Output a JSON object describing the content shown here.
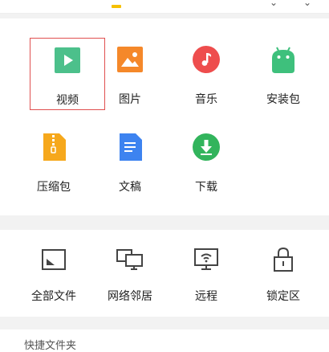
{
  "categories": [
    {
      "label": "视频",
      "icon": "video-icon",
      "color": "#4cc08b"
    },
    {
      "label": "图片",
      "icon": "image-icon",
      "color": "#f5882a"
    },
    {
      "label": "音乐",
      "icon": "music-icon",
      "color": "#ee4d4d"
    },
    {
      "label": "安装包",
      "icon": "android-icon",
      "color": "#3ec07c"
    },
    {
      "label": "压缩包",
      "icon": "zip-icon",
      "color": "#f6a81c"
    },
    {
      "label": "文稿",
      "icon": "document-icon",
      "color": "#3d83f0"
    },
    {
      "label": "下载",
      "icon": "download-icon",
      "color": "#32b45c"
    }
  ],
  "tools": [
    {
      "label": "全部文件",
      "icon": "sdcard-icon"
    },
    {
      "label": "网络邻居",
      "icon": "network-neighbors-icon"
    },
    {
      "label": "远程",
      "icon": "remote-icon"
    },
    {
      "label": "锁定区",
      "icon": "lock-icon"
    }
  ],
  "quick_folders": {
    "title": "快捷文件夹"
  },
  "colors": {
    "accent": "#f6c000",
    "selection": "#e05050",
    "icon_stroke": "#444444"
  }
}
